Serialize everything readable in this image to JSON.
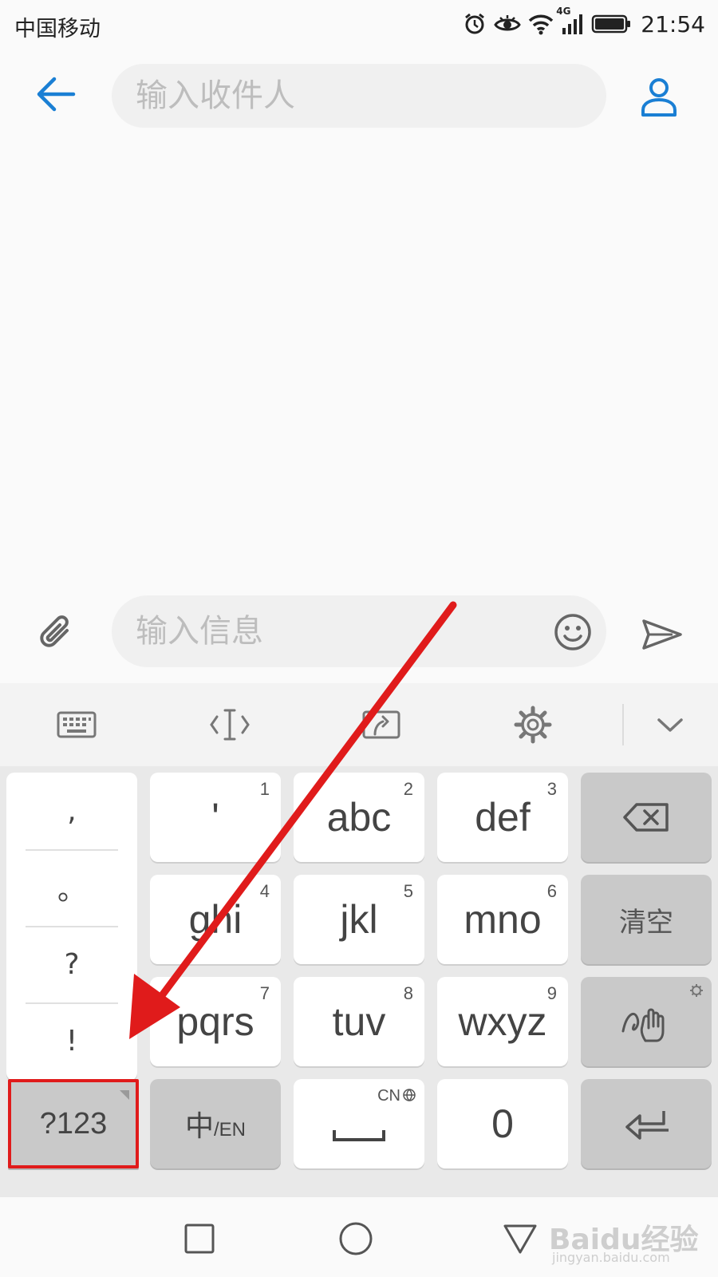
{
  "status_bar": {
    "carrier": "中国移动",
    "network": "4G",
    "time": "21:54",
    "icons": [
      "alarm-icon",
      "eye-comfort-icon",
      "wifi-icon",
      "signal-icon",
      "battery-icon"
    ]
  },
  "header": {
    "recipient_placeholder": "输入收件人",
    "back_icon": "arrow-left-icon",
    "contact_icon": "person-icon",
    "accent_color": "#1a7fd4"
  },
  "compose": {
    "message_placeholder": "输入信息",
    "attach_icon": "paperclip-icon",
    "emoji_icon": "smiley-icon",
    "send_icon": "send-icon"
  },
  "keyboard_toolbar": {
    "icons": [
      "keyboard-icon",
      "cursor-icon",
      "clipboard-icon",
      "settings-gear-icon",
      "chevron-down-icon"
    ]
  },
  "keyboard": {
    "punctuation": [
      ",",
      "。",
      "?",
      "!"
    ],
    "letter_keys": [
      {
        "label": "'",
        "number": "1"
      },
      {
        "label": "abc",
        "number": "2"
      },
      {
        "label": "def",
        "number": "3"
      },
      {
        "label": "ghi",
        "number": "4"
      },
      {
        "label": "jkl",
        "number": "5"
      },
      {
        "label": "mno",
        "number": "6"
      },
      {
        "label": "pqrs",
        "number": "7"
      },
      {
        "label": "tuv",
        "number": "8"
      },
      {
        "label": "wxyz",
        "number": "9"
      }
    ],
    "clear_label": "清空",
    "symbol_label": "?123",
    "cn_label": "中",
    "en_label": "/EN",
    "space_mode": "CN",
    "zero_label": "0",
    "side_icons": [
      "backspace-icon",
      "handwriting-icon",
      "enter-icon"
    ]
  },
  "nav_bar": {
    "icons": [
      "recent-apps-square-icon",
      "home-circle-icon",
      "back-triangle-icon"
    ]
  },
  "annotation": {
    "highlight_color": "#e01b1b"
  },
  "watermark": {
    "brand": "Baidu经验",
    "site": "jingyan.baidu.com"
  }
}
